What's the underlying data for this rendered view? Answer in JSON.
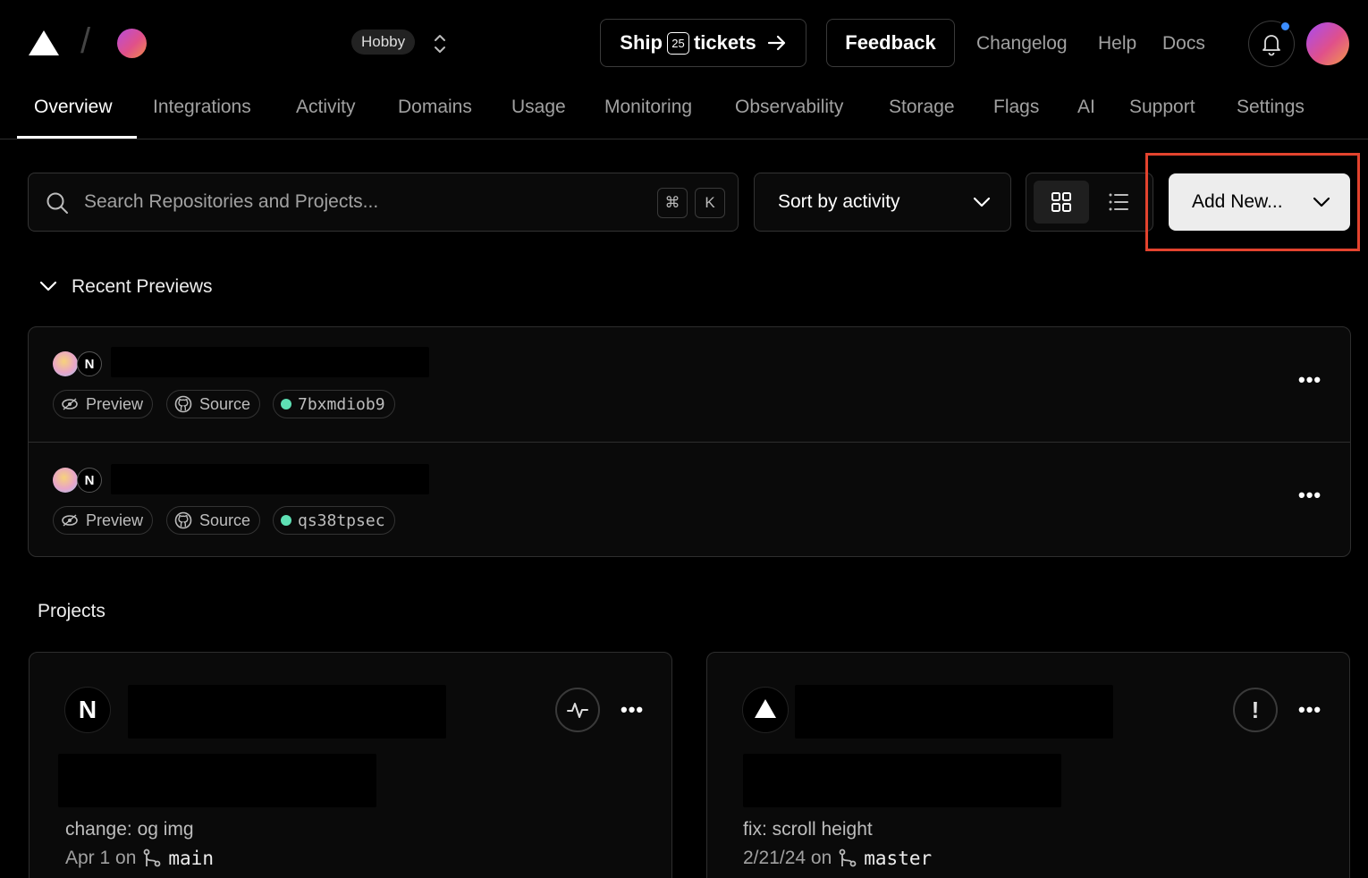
{
  "header": {
    "plan_badge": "Hobby",
    "ship_label_1": "Ship",
    "ship_badge": "25",
    "ship_label_2": "tickets",
    "feedback": "Feedback",
    "links": [
      "Changelog",
      "Help",
      "Docs"
    ]
  },
  "tabs": [
    "Overview",
    "Integrations",
    "Activity",
    "Domains",
    "Usage",
    "Monitoring",
    "Observability",
    "Storage",
    "Flags",
    "AI",
    "Support",
    "Settings"
  ],
  "active_tab": "Overview",
  "toolbar": {
    "search_placeholder": "Search Repositories and Projects...",
    "kbd_cmd": "⌘",
    "kbd_k": "K",
    "sort_label": "Sort by activity",
    "add_new": "Add New..."
  },
  "recent_previews": {
    "title": "Recent Previews",
    "items": [
      {
        "preview": "Preview",
        "source": "Source",
        "commit": "7bxmdiob9",
        "avatar_letter": "N"
      },
      {
        "preview": "Preview",
        "source": "Source",
        "commit": "qs38tpsec",
        "avatar_letter": "N"
      }
    ]
  },
  "projects": {
    "title": "Projects",
    "cards": [
      {
        "icon": "nextjs-icon",
        "icon_letter": "N",
        "commit_message": "change: og img",
        "date": "Apr 1 on",
        "branch": "main",
        "status_icon": "activity-icon"
      },
      {
        "icon": "vercel-triangle-icon",
        "commit_message": "fix: scroll height",
        "date": "2/21/24 on",
        "branch": "master",
        "status_icon": "alert-icon"
      }
    ]
  },
  "colors": {
    "background": "#000000",
    "status_ready": "#5ee0b4",
    "notification": "#3b8dff",
    "highlight": "#e3432e"
  }
}
